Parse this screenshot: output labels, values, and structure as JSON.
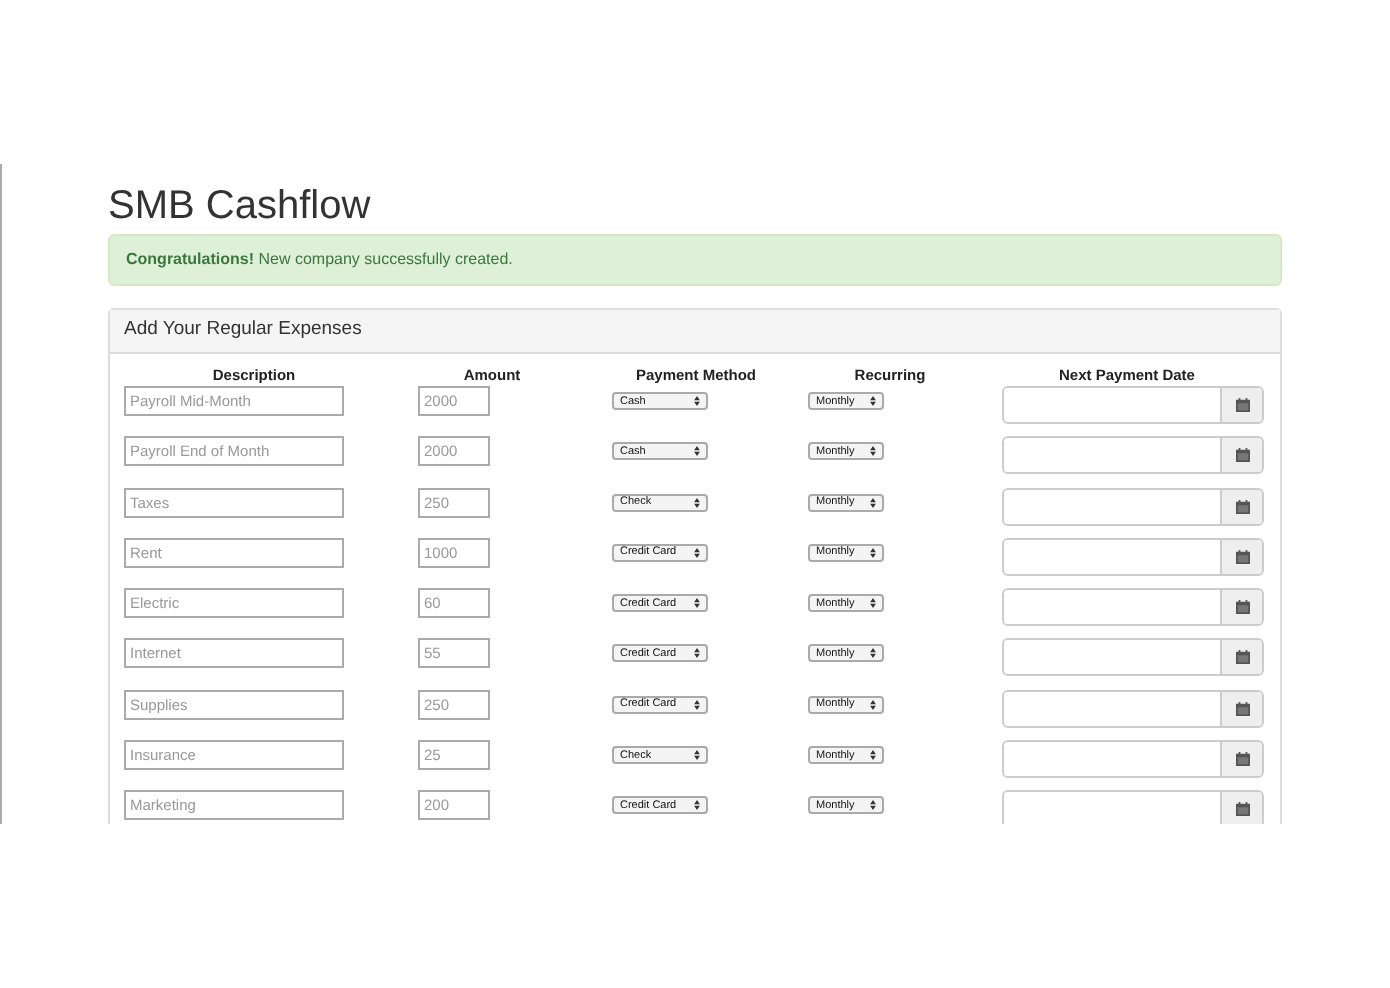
{
  "title": "SMB Cashflow",
  "alert": {
    "text": "**Congratulations!** New company successfully created."
  },
  "panel": {
    "title": "Add Your Regular Expenses",
    "columns": [
      "Description",
      "Amount",
      "Payment Method",
      "Recurring",
      "Next Payment Date"
    ],
    "rows": [
      {
        "description": "Payroll Mid-Month",
        "amount": "2000",
        "payment_method": "Cash",
        "recurring": "Monthly"
      },
      {
        "description": "Payroll End of Month",
        "amount": "2000",
        "payment_method": "Cash",
        "recurring": "Monthly"
      },
      {
        "description": "Taxes",
        "amount": "250",
        "payment_method": "Check",
        "recurring": "Monthly"
      },
      {
        "description": "Rent",
        "amount": "1000",
        "payment_method": "Credit Card",
        "recurring": "Monthly"
      },
      {
        "description": "Electric",
        "amount": "60",
        "payment_method": "Credit Card",
        "recurring": "Monthly"
      },
      {
        "description": "Internet",
        "amount": "55",
        "payment_method": "Credit Card",
        "recurring": "Monthly"
      },
      {
        "description": "Supplies",
        "amount": "250",
        "payment_method": "Credit Card",
        "recurring": "Monthly"
      },
      {
        "description": "Insurance",
        "amount": "25",
        "payment_method": "Check",
        "recurring": "Monthly"
      },
      {
        "description": "Marketing",
        "amount": "200",
        "payment_method": "Credit Card",
        "recurring": "Monthly"
      }
    ]
  }
}
